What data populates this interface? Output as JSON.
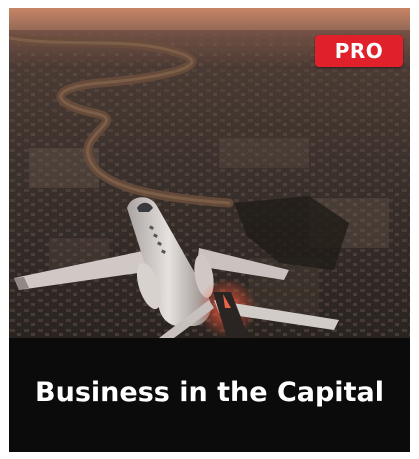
{
  "card": {
    "badge_label": "PRO",
    "title": "Business in the Capital"
  },
  "colors": {
    "badge": "#e0202b",
    "caption_background": "#0b0b0b",
    "caption_text": "#ffffff"
  }
}
